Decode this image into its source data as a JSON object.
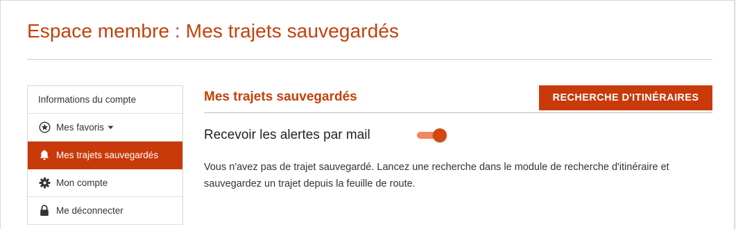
{
  "page": {
    "title": "Espace membre : Mes trajets sauvegardés"
  },
  "sidebar": {
    "items": [
      {
        "label": "Informations du compte",
        "icon": "none",
        "active": false
      },
      {
        "label": "Mes favoris",
        "icon": "star-circle-icon",
        "active": false,
        "has_dropdown": true
      },
      {
        "label": "Mes trajets sauvegardés",
        "icon": "bell-icon",
        "active": true
      },
      {
        "label": "Mon compte",
        "icon": "gear-icon",
        "active": false
      },
      {
        "label": "Me déconnecter",
        "icon": "lock-icon",
        "active": false
      }
    ]
  },
  "main": {
    "section_title": "Mes trajets sauvegardés",
    "search_button_label": "RECHERCHE D'ITINÉRAIRES",
    "alerts": {
      "label": "Recevoir les alertes par mail",
      "enabled": true
    },
    "empty_message": "Vous n'avez pas de trajet sauvegardé. Lancez une recherche dans le module de recherche d'itinéraire et sauvegardez un trajet depuis la feuille de route."
  },
  "colors": {
    "accent": "#c83a09",
    "title": "#c2410c",
    "toggle_track": "#f0875f",
    "toggle_knob": "#d1470f"
  }
}
